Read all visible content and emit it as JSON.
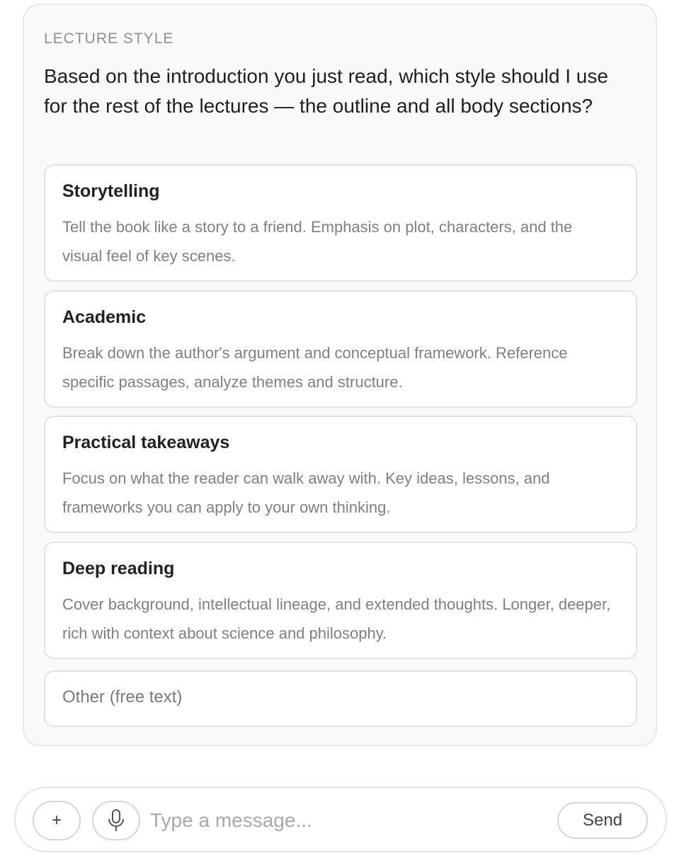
{
  "prompt_card": {
    "label": "LECTURE STYLE",
    "question": "Based on the introduction you just read, which style should I use for the rest of the lectures — the outline and all body sections?",
    "options": [
      {
        "title": "Storytelling",
        "description": "Tell the book like a story to a friend. Emphasis on plot, characters, and the visual feel of key scenes."
      },
      {
        "title": "Academic",
        "description": "Break down the author's argument and conceptual framework. Reference specific passages, analyze themes and structure."
      },
      {
        "title": "Practical takeaways",
        "description": "Focus on what the reader can walk away with. Key ideas, lessons, and frameworks you can apply to your own thinking."
      },
      {
        "title": "Deep reading",
        "description": "Cover background, intellectual lineage, and extended thoughts. Longer, deeper, rich with context about science and philosophy."
      }
    ],
    "other_option_label": "Other (free text)"
  },
  "composer": {
    "add_button_icon": "plus-icon",
    "mic_button_icon": "microphone-icon",
    "input_value": "",
    "input_placeholder": "Type a message...",
    "send_label": "Send"
  }
}
